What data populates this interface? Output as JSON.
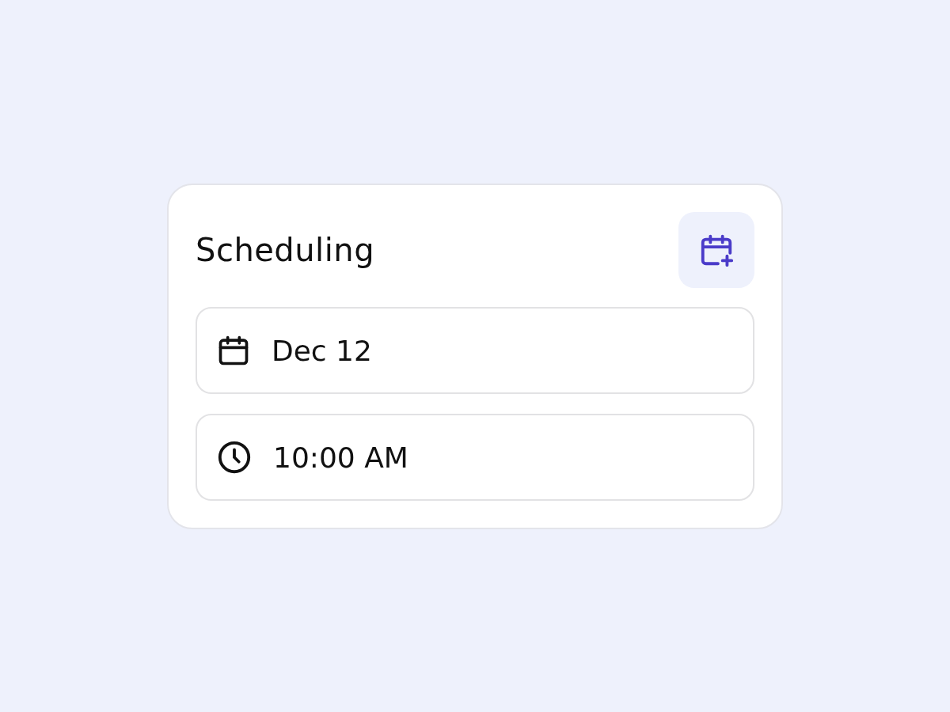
{
  "card": {
    "title": "Scheduling",
    "fields": [
      {
        "kind": "date",
        "value": "Dec 12"
      },
      {
        "kind": "time",
        "value": "10:00 AM"
      }
    ]
  }
}
